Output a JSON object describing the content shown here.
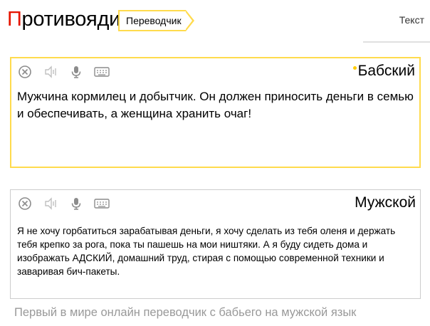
{
  "header": {
    "logo_first": "П",
    "logo_rest": "ротивоядие",
    "service": "Переводчик",
    "tab": "Текст"
  },
  "source": {
    "language": "Бабский",
    "text": "Мужчина кормилец и добытчик. Он должен приносить деньги в семью и обеспечивать, а женщина хранить очаг!"
  },
  "target": {
    "language": "Мужской",
    "text": "Я не хочу горбатиться зарабатывая деньги, я хочу сделать из тебя оленя и держать тебя крепко за рога, пока ты пашешь на мои ништяки. А я буду сидеть дома и изображать АДСКИЙ, домашний труд, стирая с помощью современной техники и заваривая бич-пакеты."
  },
  "footer": {
    "tagline": "Первый в мире онлайн переводчик с бабьего на мужской язык"
  },
  "toolbar_icons": [
    "clear-icon",
    "speaker-icon",
    "microphone-icon",
    "keyboard-icon"
  ],
  "colors": {
    "accent": "#ffdb4d",
    "logo_red": "#e61400",
    "icon_gray": "#8c8c8c",
    "footer_gray": "#999999"
  }
}
